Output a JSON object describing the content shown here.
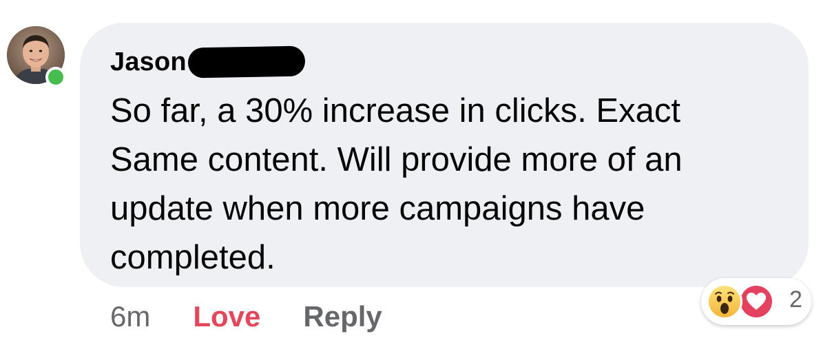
{
  "comment": {
    "author_name": "Jason",
    "message": "So far, a 30% increase in clicks.  Exact\nSame content. Will provide more of an\nupdate when more campaigns have\ncompleted.",
    "online_status_color": "#45bd4f",
    "bubble_color": "#eff0f3"
  },
  "actions": {
    "timestamp": "6m",
    "love_label": "Love",
    "love_color": "#e4465a",
    "reply_label": "Reply"
  },
  "reactions": {
    "icons": [
      "wow-icon",
      "love-icon"
    ],
    "count": "2"
  }
}
